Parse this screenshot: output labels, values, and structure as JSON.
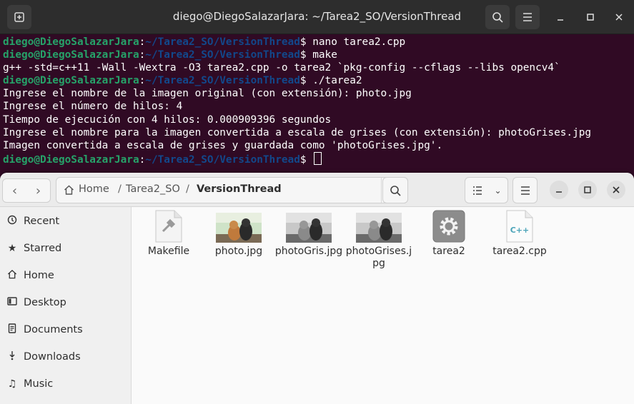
{
  "terminal": {
    "title": "diego@DiegoSalazarJara: ~/Tarea2_SO/VersionThread",
    "prompt_user": "diego@DiegoSalazarJara",
    "prompt_path": "~/Tarea2_SO/VersionThread",
    "lines": [
      {
        "type": "cmd",
        "text": "nano tarea2.cpp"
      },
      {
        "type": "cmd",
        "text": "make"
      },
      {
        "type": "out",
        "text": "g++ -std=c++11 -Wall -Wextra -O3 tarea2.cpp -o tarea2 `pkg-config --cflags --libs opencv4`"
      },
      {
        "type": "cmd",
        "text": "./tarea2"
      },
      {
        "type": "out",
        "text": "Ingrese el nombre de la imagen original (con extensión): photo.jpg"
      },
      {
        "type": "out",
        "text": "Ingrese el número de hilos: 4"
      },
      {
        "type": "out",
        "text": "Tiempo de ejecución con 4 hilos: 0.000909396 segundos"
      },
      {
        "type": "out",
        "text": "Ingrese el nombre para la imagen convertida a escala de grises (con extensión): photoGrises.jpg"
      },
      {
        "type": "out",
        "text": "Imagen convertida a escala de grises y guardada como 'photoGrises.jpg'."
      },
      {
        "type": "cmd",
        "text": ""
      }
    ]
  },
  "files": {
    "path": [
      "Home",
      "Tarea2_SO",
      "VersionThread"
    ],
    "path_sep": "/",
    "sidebar": [
      {
        "label": "Recent",
        "icon": "clock-icon"
      },
      {
        "label": "Starred",
        "icon": "star-icon"
      },
      {
        "label": "Home",
        "icon": "home-icon"
      },
      {
        "label": "Desktop",
        "icon": "desktop-icon"
      },
      {
        "label": "Documents",
        "icon": "documents-icon"
      },
      {
        "label": "Downloads",
        "icon": "downloads-icon"
      },
      {
        "label": "Music",
        "icon": "music-icon"
      }
    ],
    "items": [
      {
        "name": "Makefile",
        "kind": "makefile-icon"
      },
      {
        "name": "photo.jpg",
        "kind": "image-thumbnail"
      },
      {
        "name": "photoGris.jpg",
        "kind": "image-thumbnail-gray"
      },
      {
        "name": "photoGrises.jpg",
        "kind": "image-thumbnail-gray"
      },
      {
        "name": "tarea2",
        "kind": "executable-icon"
      },
      {
        "name": "tarea2.cpp",
        "kind": "cpp-file-icon",
        "badge": "C++"
      }
    ]
  },
  "colors": {
    "terminal_bg": "#300a24",
    "prompt_user": "#26a269",
    "prompt_path": "#12488b"
  }
}
